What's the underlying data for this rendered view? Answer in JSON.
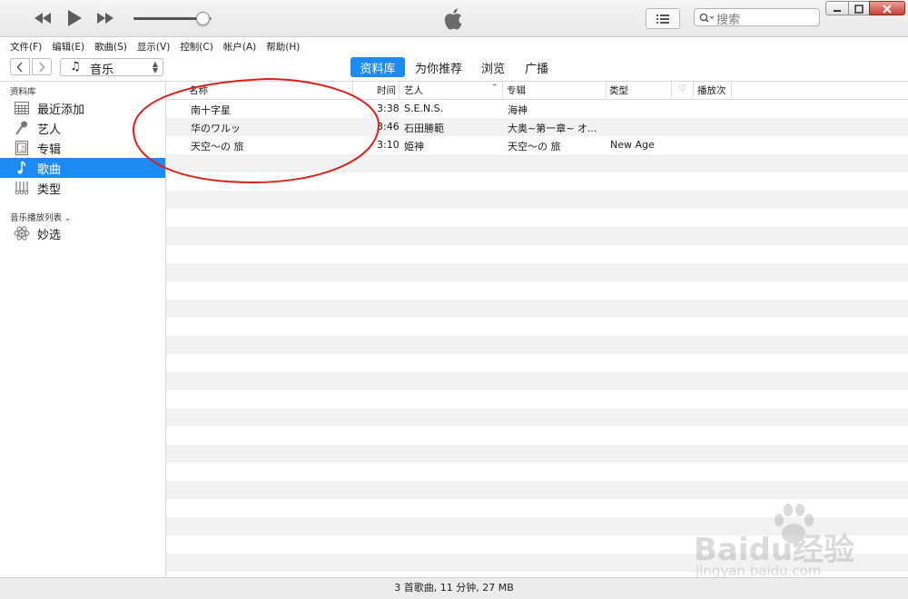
{
  "window": {
    "title_logo": "apple-logo"
  },
  "player": {
    "volume": 0.88
  },
  "search": {
    "placeholder": "搜索"
  },
  "menu": [
    "文件(F)",
    "编辑(E)",
    "歌曲(S)",
    "显示(V)",
    "控制(C)",
    "帐户(A)",
    "帮助(H)"
  ],
  "nav": {
    "media_kind": "音乐",
    "tabs": [
      {
        "label": "资料库",
        "active": true
      },
      {
        "label": "为你推荐",
        "active": false
      },
      {
        "label": "浏览",
        "active": false
      },
      {
        "label": "广播",
        "active": false
      }
    ]
  },
  "sidebar": {
    "library_header": "资料库",
    "library_items": [
      {
        "label": "最近添加",
        "icon": "grid-icon",
        "selected": false
      },
      {
        "label": "艺人",
        "icon": "microphone-icon",
        "selected": false
      },
      {
        "label": "专辑",
        "icon": "album-icon",
        "selected": false
      },
      {
        "label": "歌曲",
        "icon": "music-note-icon",
        "selected": true
      },
      {
        "label": "类型",
        "icon": "genre-icon",
        "selected": false
      }
    ],
    "playlists_header": "音乐播放列表",
    "playlist_items": [
      {
        "label": "妙选",
        "icon": "genius-icon"
      }
    ]
  },
  "table": {
    "columns": {
      "name": "名称",
      "time": "时间",
      "artist": "艺人",
      "album": "专辑",
      "genre": "类型",
      "plays": "播放次"
    },
    "sort_column": "artist",
    "rows": [
      {
        "name": "南十字星",
        "time": "3:38",
        "artist": "S.E.N.S.",
        "album": "海神",
        "genre": ""
      },
      {
        "name": "华のワルッ",
        "time": "3:46",
        "artist": "石田勝範",
        "album": "大奥~第一章~ オ...",
        "genre": ""
      },
      {
        "name": "天空～の 旅",
        "time": "3:10",
        "artist": "姫神",
        "album": "天空～の 旅",
        "genre": "New Age"
      }
    ]
  },
  "status": "3 首歌曲, 11 分钟, 27 MB",
  "watermark": {
    "brand": "Baidu经验",
    "url": "jingyan.baidu.com"
  },
  "colors": {
    "accent": "#1e8bf5",
    "annotation": "#d9201b"
  }
}
